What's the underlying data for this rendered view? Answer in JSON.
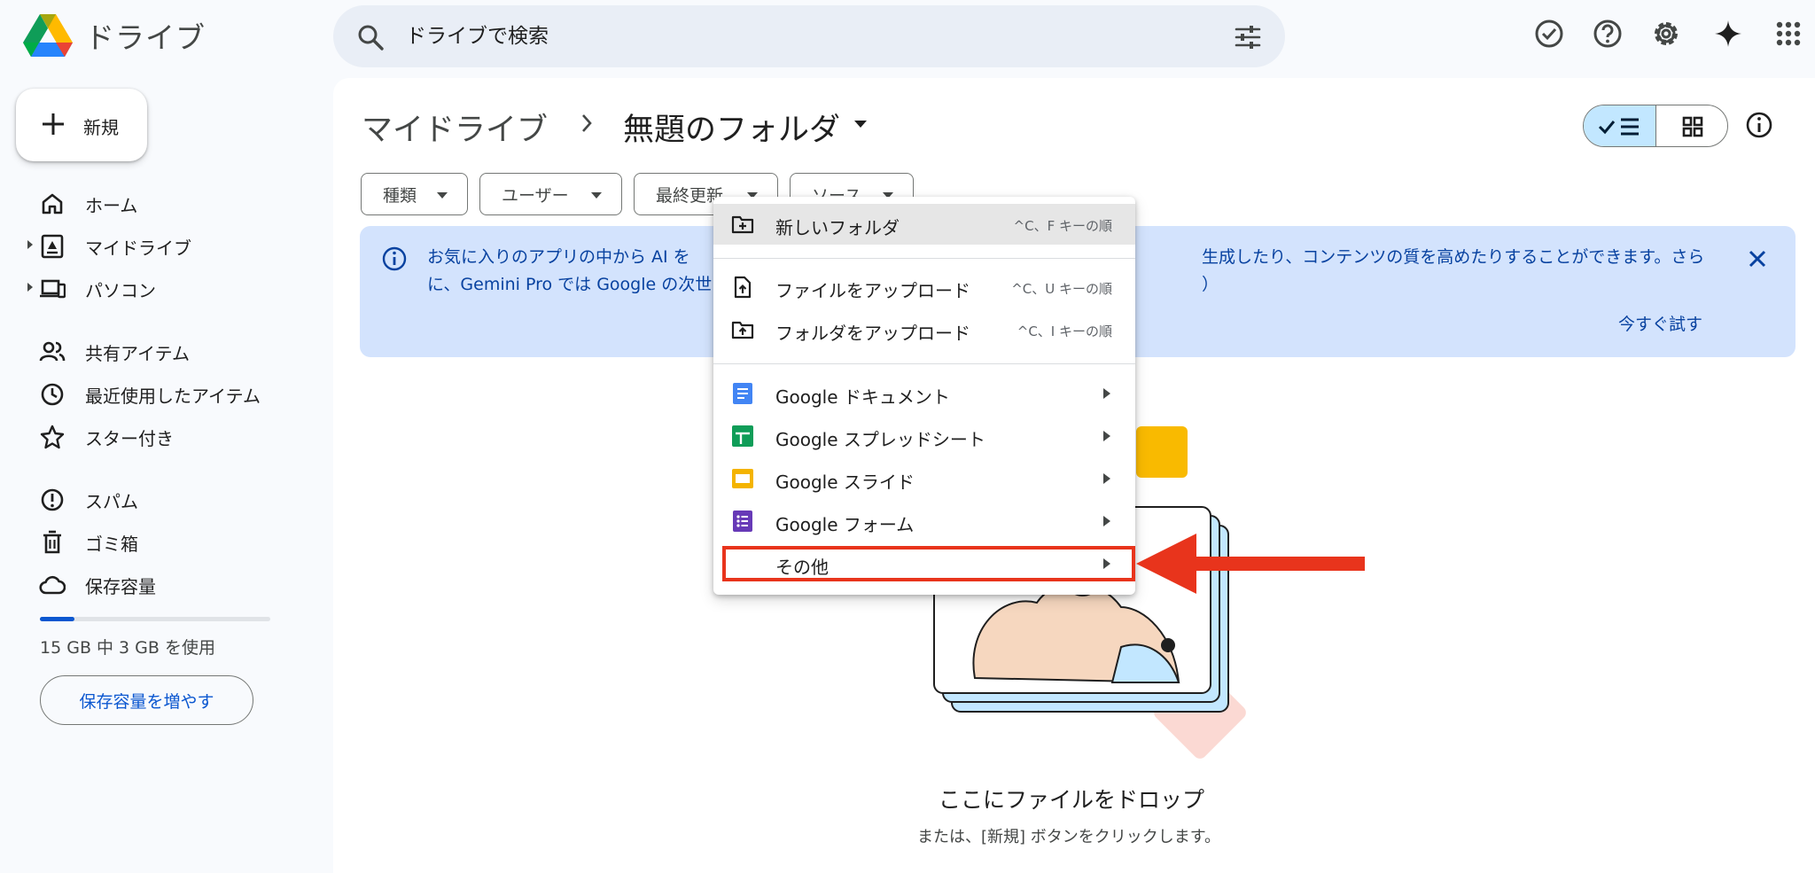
{
  "header": {
    "app_title": "ドライブ",
    "search_placeholder": "ドライブで検索",
    "icons": [
      "search-icon",
      "tune-icon",
      "task-check-icon",
      "help-icon",
      "settings-icon",
      "gemini-sparkle-icon",
      "apps-grid-icon"
    ]
  },
  "sidebar": {
    "new_label": "新規",
    "items": [
      {
        "label": "ホーム",
        "icon": "home-icon"
      },
      {
        "label": "マイドライブ",
        "icon": "my-drive-icon"
      },
      {
        "label": "パソコン",
        "icon": "computers-icon"
      },
      {
        "label": "共有アイテム",
        "icon": "shared-icon"
      },
      {
        "label": "最近使用したアイテム",
        "icon": "recent-icon"
      },
      {
        "label": "スター付き",
        "icon": "star-icon"
      },
      {
        "label": "スパム",
        "icon": "spam-icon"
      },
      {
        "label": "ゴミ箱",
        "icon": "trash-icon"
      },
      {
        "label": "保存容量",
        "icon": "cloud-icon"
      }
    ],
    "storage": {
      "used_fraction": 0.15,
      "text": "15 GB 中 3 GB を使用",
      "button_label": "保存容量を増やす"
    }
  },
  "main": {
    "breadcrumb_root": "マイドライブ",
    "breadcrumb_current": "無題のフォルダ",
    "filters": [
      "種類",
      "ユーザー",
      "最終更新",
      "ソース"
    ],
    "banner": {
      "line1_left": "お気に入りのアプリの中から AI を",
      "line1_right": "生成したり、コンテンツの質を高めたりすることができます。さら",
      "line2_left": "に、Gemini Pro では Google の次世",
      "line2_right": "）",
      "try_label": "今すぐ試す"
    },
    "empty_title": "ここにファイルをドロップ",
    "empty_sub": "または、[新規] ボタンをクリックします。"
  },
  "menu": {
    "items": [
      {
        "label": "新しいフォルダ",
        "shortcut": "^C、F キーの順",
        "icon": "new-folder-icon"
      },
      {
        "label": "ファイルをアップロード",
        "shortcut": "^C、U キーの順",
        "icon": "file-upload-icon"
      },
      {
        "label": "フォルダをアップロード",
        "shortcut": "^C、I キーの順",
        "icon": "folder-upload-icon"
      },
      {
        "label": "Google ドキュメント",
        "icon": "google-docs-icon"
      },
      {
        "label": "Google スプレッドシート",
        "icon": "google-sheets-icon"
      },
      {
        "label": "Google スライド",
        "icon": "google-slides-icon"
      },
      {
        "label": "Google フォーム",
        "icon": "google-forms-icon"
      },
      {
        "label": "その他",
        "icon": ""
      }
    ]
  },
  "colors": {
    "accent": "#0b57d0",
    "banner_bg": "#d3e3fd",
    "annotation": "#e8341c",
    "docs": "#4285f4",
    "sheets": "#0f9d58",
    "slides": "#f4b400",
    "forms": "#673ab7"
  }
}
